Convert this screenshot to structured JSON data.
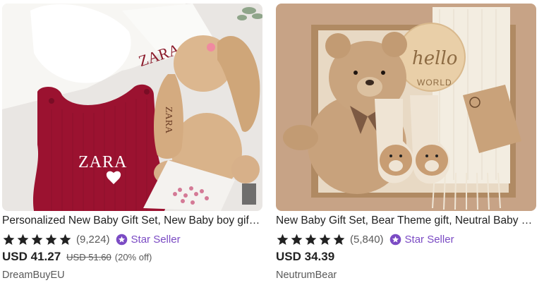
{
  "listings": [
    {
      "title": "Personalized New Baby Gift Set, New Baby boy gift, Newborn Gift Box",
      "rating_value": 5,
      "review_count": "(9,224)",
      "star_seller_label": "Star Seller",
      "price": "USD 41.27",
      "original_price": "USD 51.60",
      "discount": "(20% off)",
      "shop_name": "DreamBuyEU",
      "image": {
        "description": "white robe, red ribbed romper and plush bunny embroidered ZARA",
        "embroidered_name": "ZARA"
      }
    },
    {
      "title": "New Baby Gift Set, Bear Theme gift, Neutral Baby Gift",
      "rating_value": 5,
      "review_count": "(5,840)",
      "star_seller_label": "Star Seller",
      "price": "USD 34.39",
      "shop_name": "NeutrumBear",
      "image": {
        "description": "teddy bear, bear socks, hello world plaque and muslin blanket",
        "plaque_text": "hello",
        "plaque_text_2": "WORLD"
      }
    }
  ],
  "colors": {
    "star": "#222222",
    "star_seller": "#7b4bc4",
    "text_muted": "#595959"
  },
  "icons": {
    "star": "star-icon",
    "badge": "star-seller-badge-icon"
  }
}
